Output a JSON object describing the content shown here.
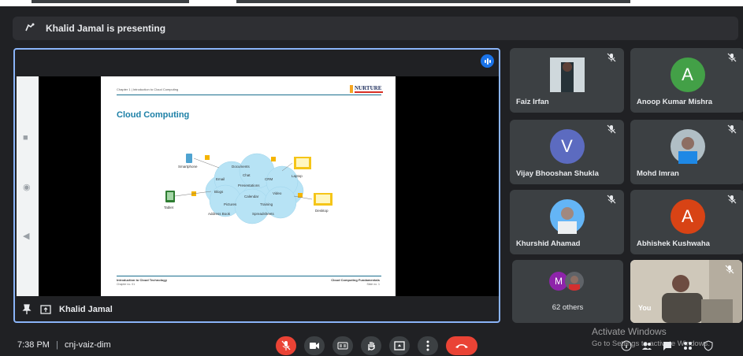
{
  "presenting_banner": {
    "text": "Khalid Jamal is presenting",
    "icon": "present-hand-icon"
  },
  "stage": {
    "presenter_name": "Khalid Jamal",
    "slide": {
      "chapter": "Chapter 1 | Introduction to Cloud Computing",
      "logo_text": "NURTURE",
      "title": "Cloud Computing",
      "diagram_labels": [
        "Smartphone",
        "Laptop",
        "Tablet",
        "Desktop",
        "Documents",
        "Email",
        "Chat",
        "CRM",
        "Presentations",
        "Blogs",
        "Video",
        "Calendar",
        "Pictures",
        "Training",
        "Address Book",
        "Spreadsheets"
      ],
      "footer_left": "Introduction to Cloud Technology",
      "footer_left_sub": "Chapter no. 01",
      "footer_right": "Cloud Computing Fundamentals",
      "footer_right_sub": "Slide no. 1"
    }
  },
  "participants": [
    {
      "name": "Faiz Irfan",
      "type": "photo"
    },
    {
      "name": "Anoop Kumar Mishra",
      "type": "letter",
      "letter": "A",
      "color": "#43a047"
    },
    {
      "name": "Vijay Bhooshan Shukla",
      "type": "letter",
      "letter": "V",
      "color": "#5c6bc0"
    },
    {
      "name": "Mohd Imran",
      "type": "photo"
    },
    {
      "name": "Khurshid Ahamad",
      "type": "photo"
    },
    {
      "name": "Abhishek Kushwaha",
      "type": "letter",
      "letter": "A",
      "color": "#d84315"
    }
  ],
  "others": {
    "letter": "M",
    "count_label": "62 others"
  },
  "self_tile": {
    "label": "You"
  },
  "bottom_bar": {
    "time": "7:38 PM",
    "separator": "|",
    "meeting_code": "cnj-vaiz-dim"
  },
  "watermark": {
    "line1": "Activate Windows",
    "line2": "Go to Settings to activate Windows."
  }
}
